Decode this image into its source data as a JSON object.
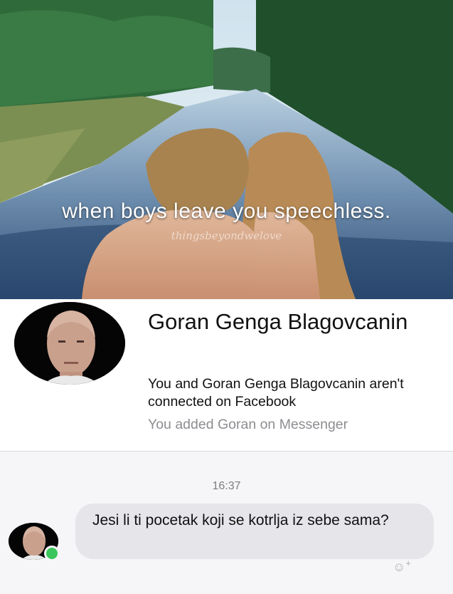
{
  "cover": {
    "caption": "when boys leave you speechless.",
    "watermark": "thingsbeyondwelove"
  },
  "profile": {
    "name": "Goran Genga Blagovcanin",
    "connection_note": "You and Goran Genga Blagovcanin aren't connected on Facebook",
    "added_note": "You added Goran on Messenger"
  },
  "chat": {
    "timestamp": "16:37",
    "messages": [
      {
        "text": "Jesi li ti pocetak koji se kotrlja iz sebe sama?"
      }
    ]
  },
  "colors": {
    "bubble": "#e5e5ea",
    "online": "#3ac65a",
    "muted_text": "#8d8d92"
  },
  "icons": {
    "reaction": "smiley-plus-icon"
  }
}
